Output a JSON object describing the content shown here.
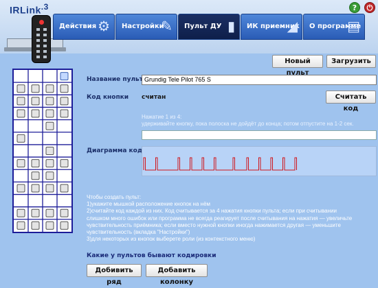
{
  "app": {
    "logo": "IRLink",
    "logo_version": ".3"
  },
  "window_controls": {
    "help_label": "?",
    "close_label": "⏻"
  },
  "tabs": [
    {
      "label": "Действия",
      "icon": "gear-icon"
    },
    {
      "label": "Настройки",
      "icon": "wrench-icon"
    },
    {
      "label": "Пульт ДУ",
      "icon": "remote-icon"
    },
    {
      "label": "ИК приемник",
      "icon": "receiver-icon"
    },
    {
      "label": "О программе",
      "icon": "printer-icon"
    }
  ],
  "active_tab": "Пульт ДУ",
  "toolbar": {
    "new_remote": "Новый пульт",
    "load": "Загрузить"
  },
  "form": {
    "name_label": "Название пульта",
    "name_value": "Grundig Tele Pilot 765 S",
    "code_label": "Код кнопки",
    "code_status": "считан",
    "read_code": "Считать код",
    "hint_line1": "Нажатие 1 из 4:",
    "hint_line2": "удерживайте кнопку, пока полоска не дойдёт до конца; потом отпустите на 1-2 сек.",
    "diagram_label": "Диаграмма кода"
  },
  "instructions": [
    "Чтобы создать пульт:",
    "1)укажите мышкой расположение кнопок на нём",
    "2)считайте код каждой из них. Код считывается за 4 нажатия кнопки пульта; если при считывании",
    "слишком много ошибок или программа не всегда реагирует после считывания на нажатия — увеличьте",
    "чувствительность приёмника; если вместо нужной кнопки иногда нажимается другая — уменьшите",
    "чувствительность (вкладка \"Настройки\")",
    "3)для некоторых из кнопок выберете роли (из контекстного меню)"
  ],
  "link_encodings": "Какие у пультов бывают кодировки",
  "bottom": {
    "add_row": "Добивить ряд",
    "add_column": "Добавить колонку"
  },
  "button_grid": {
    "columns": 4,
    "rows": 13,
    "cells": [
      [
        0,
        0,
        0,
        2
      ],
      [
        1,
        1,
        1,
        1
      ],
      [
        1,
        1,
        1,
        1
      ],
      [
        1,
        1,
        1,
        1
      ],
      [
        0,
        0,
        1,
        0
      ],
      [
        1,
        0,
        0,
        0
      ],
      [
        0,
        0,
        1,
        0
      ],
      [
        1,
        1,
        1,
        1
      ],
      [
        0,
        1,
        1,
        0
      ],
      [
        1,
        1,
        1,
        1
      ],
      [
        0,
        0,
        0,
        0
      ],
      [
        1,
        1,
        1,
        1
      ],
      [
        1,
        1,
        1,
        1
      ]
    ],
    "colors": {
      "border": "#1c1c98",
      "button": "#e4e4e4",
      "selected": "#c3d9ff"
    }
  },
  "colors": {
    "background": "#9fc3ee",
    "tab": "#3a6ec9",
    "tab_active": "#142858",
    "signal": "#d0141a"
  },
  "signal_segments": [
    [
      0,
      1
    ],
    [
      7,
      1
    ],
    [
      20,
      1
    ],
    [
      27,
      1
    ],
    [
      34,
      1
    ],
    [
      41,
      1
    ],
    [
      52,
      1
    ],
    [
      60,
      1
    ],
    [
      67,
      1
    ],
    [
      74,
      1
    ],
    [
      81,
      1
    ],
    [
      88,
      1
    ]
  ]
}
